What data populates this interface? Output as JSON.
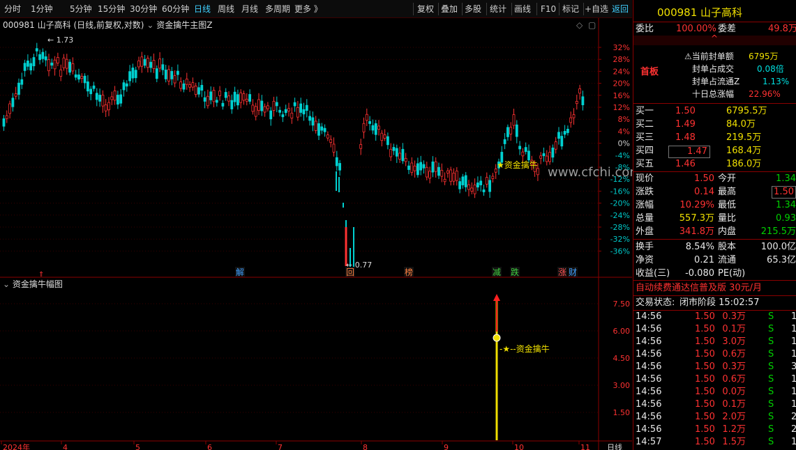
{
  "toolbar": {
    "periods": [
      "分时",
      "1分钟",
      "5分钟",
      "15分钟",
      "30分钟",
      "60分钟",
      "日线",
      "周线",
      "月线",
      "多周期",
      "更多 》"
    ],
    "actions": [
      "复权",
      "叠加",
      "多股",
      "统计",
      "画线",
      "F10",
      "标记",
      "+自选",
      "返回"
    ]
  },
  "main_chart": {
    "title_code": "000981",
    "title_name": "山子高科",
    "title_mode": "(日线,前复权,对数)",
    "indicator": "资金擒牛主图Z",
    "high_label": "1.73",
    "low_label": "0.77",
    "signal_label": "★资金擒牛",
    "watermark": "www.cfchi.com",
    "y_ticks": [
      "32%",
      "28%",
      "24%",
      "20%",
      "16%",
      "12%",
      "8%",
      "4%",
      "0%",
      "-4%",
      "-8%",
      "-12%",
      "-16%",
      "-20%",
      "-24%",
      "-28%",
      "-32%",
      "-36%"
    ],
    "markers": [
      {
        "text": "解",
        "color": "#40a0ff"
      },
      {
        "text": "回",
        "color": "#ff8040"
      },
      {
        "text": "榜",
        "color": "#ff8040"
      },
      {
        "text": "减",
        "color": "#40d040"
      },
      {
        "text": "跌",
        "color": "#40d040"
      },
      {
        "text": "涨",
        "color": "#ff5050"
      },
      {
        "text": "财",
        "color": "#40a0ff"
      }
    ]
  },
  "sub_chart": {
    "title": "资金擒牛幅图",
    "signal_label": "-★--资金擒牛",
    "y_ticks": [
      "7.50",
      "6.00",
      "4.50",
      "3.00",
      "1.50"
    ]
  },
  "x_axis": {
    "labels": [
      "2024年",
      "4",
      "5",
      "6",
      "7",
      "8",
      "9",
      "10",
      "11"
    ],
    "period": "日线"
  },
  "quote": {
    "code": "000981",
    "name": "山子高科",
    "wei_bi_label": "委比",
    "wei_bi_value": "100.00%",
    "wei_cha_label": "委差",
    "wei_cha_value": "49.8万",
    "badge": "首板",
    "seal_rows": [
      {
        "label": "当前封单额",
        "value": "6795万",
        "color": "yel"
      },
      {
        "label": "封单占成交",
        "value": "0.08倍",
        "color": "cyn"
      },
      {
        "label": "封单占流通Z",
        "value": "1.13%",
        "color": "cyn"
      },
      {
        "label": "十日总涨幅",
        "value": "22.96%",
        "color": "red"
      }
    ],
    "bids": [
      {
        "label": "买一",
        "price": "1.50",
        "vol": "6795.5万"
      },
      {
        "label": "买二",
        "price": "1.49",
        "vol": "84.0万"
      },
      {
        "label": "买三",
        "price": "1.48",
        "vol": "219.5万"
      },
      {
        "label": "买四",
        "price": "1.47",
        "vol": "168.4万"
      },
      {
        "label": "买五",
        "price": "1.46",
        "vol": "186.0万"
      }
    ],
    "stats": [
      {
        "l1": "现价",
        "v1": "1.50",
        "c1": "red",
        "l2": "今开",
        "v2": "1.34",
        "c2": "grn"
      },
      {
        "l1": "涨跌",
        "v1": "0.14",
        "c1": "red",
        "l2": "最高",
        "v2": "1.50",
        "c2": "red"
      },
      {
        "l1": "涨幅",
        "v1": "10.29%",
        "c1": "red",
        "l2": "最低",
        "v2": "1.34",
        "c2": "grn"
      },
      {
        "l1": "总量",
        "v1": "557.3万",
        "c1": "yel",
        "l2": "量比",
        "v2": "0.93",
        "c2": "grn"
      },
      {
        "l1": "外盘",
        "v1": "341.8万",
        "c1": "red",
        "l2": "内盘",
        "v2": "215.5万",
        "c2": "grn"
      }
    ],
    "stats2": [
      {
        "l1": "换手",
        "v1": "8.54%",
        "l2": "股本",
        "v2": "100.0亿"
      },
      {
        "l1": "净资",
        "v1": "0.21",
        "l2": "流通",
        "v2": "65.3亿"
      },
      {
        "l1": "收益(三)",
        "v1": "-0.080",
        "l2": "PE(动)",
        "v2": ""
      }
    ],
    "ad_text": "自动续费通达信普及版  30元/月",
    "trade_status_label": "交易状态:",
    "trade_status_value": "闭市阶段 15:02:57",
    "ticks": [
      {
        "t": "14:56",
        "p": "1.50",
        "v": "0.3万",
        "s": "S",
        "n": "1"
      },
      {
        "t": "14:56",
        "p": "1.50",
        "v": "0.1万",
        "s": "S",
        "n": "1"
      },
      {
        "t": "14:56",
        "p": "1.50",
        "v": "3.0万",
        "s": "S",
        "n": "1"
      },
      {
        "t": "14:56",
        "p": "1.50",
        "v": "0.6万",
        "s": "S",
        "n": "1"
      },
      {
        "t": "14:56",
        "p": "1.50",
        "v": "0.3万",
        "s": "S",
        "n": "3"
      },
      {
        "t": "14:56",
        "p": "1.50",
        "v": "0.6万",
        "s": "S",
        "n": "1"
      },
      {
        "t": "14:56",
        "p": "1.50",
        "v": "0.0万",
        "s": "S",
        "n": "1"
      },
      {
        "t": "14:56",
        "p": "1.50",
        "v": "0.1万",
        "s": "S",
        "n": "1"
      },
      {
        "t": "14:56",
        "p": "1.50",
        "v": "2.0万",
        "s": "S",
        "n": "2"
      },
      {
        "t": "14:56",
        "p": "1.50",
        "v": "1.2万",
        "s": "S",
        "n": "2"
      },
      {
        "t": "14:57",
        "p": "1.50",
        "v": "1.5万",
        "s": "S",
        "n": "1"
      }
    ]
  }
}
